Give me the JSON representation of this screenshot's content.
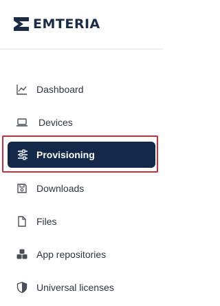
{
  "brand": {
    "name": "EMTERIA",
    "color": "#1a2b45"
  },
  "nav": {
    "items": [
      {
        "label": "Dashboard",
        "icon": "chart-line-icon"
      },
      {
        "label": "Devices",
        "icon": "laptop-icon"
      },
      {
        "label": "Provisioning",
        "icon": "sliders-icon",
        "active": true
      },
      {
        "label": "Downloads",
        "icon": "floppy-disk-icon"
      },
      {
        "label": "Files",
        "icon": "file-icon"
      },
      {
        "label": "App repositories",
        "icon": "cubes-icon"
      },
      {
        "label": "Universal licenses",
        "icon": "shield-icon"
      }
    ]
  },
  "colors": {
    "active_bg": "#14294a",
    "highlight_border": "#c5303a",
    "text": "#2f3440"
  }
}
